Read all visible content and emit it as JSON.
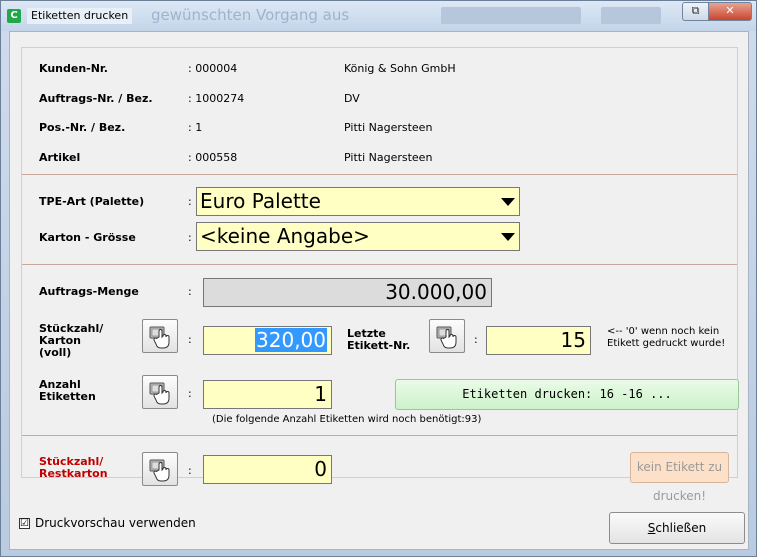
{
  "window": {
    "title": "Etiketten drucken",
    "app_icon_letter": "C",
    "background_hint": "gewünschten Vorgang aus",
    "minimize_label": "⧉",
    "close_label": "✕"
  },
  "info": {
    "kunden_label": "Kunden-Nr.",
    "kunden_value": ": 000004",
    "kunden_name": "König & Sohn GmbH",
    "auftrag_label": "Auftrags-Nr. / Bez.",
    "auftrag_value": ": 1000274",
    "auftrag_name": "DV",
    "pos_label": "Pos.-Nr. / Bez.",
    "pos_value": ": 1",
    "pos_name": "Pitti Nagersteen",
    "artikel_label": "Artikel",
    "artikel_value": ": 000558",
    "artikel_name": "Pitti Nagersteen"
  },
  "tpe": {
    "label": "TPE-Art (Palette)",
    "value": "Euro Palette"
  },
  "karton": {
    "label": "Karton - Grösse",
    "value": "<keine Angabe>"
  },
  "menge": {
    "label": "Auftrags-Menge",
    "value": "30.000,00"
  },
  "stueckzahl": {
    "label_line1": "Stückzahl/",
    "label_line2": "Karton",
    "label_line3": "(voll)",
    "value": "320,00"
  },
  "letzte": {
    "label_line1": "Letzte",
    "label_line2": "Etikett-Nr.",
    "value": "15",
    "hint_line1": "<-- '0' wenn noch kein",
    "hint_line2": "Etikett gedruckt wurde!"
  },
  "anzahl": {
    "label_line1": "Anzahl",
    "label_line2": "Etiketten",
    "value": "1",
    "print_button": "Etiketten drucken: 16 -16 ...",
    "note": "(Die folgende Anzahl Etiketten wird noch benötigt:93)"
  },
  "rest": {
    "label_line1": "Stückzahl/",
    "label_line2": "Restkarton",
    "value": "0",
    "button": "kein Etikett zu drucken!"
  },
  "colon": ":",
  "footer": {
    "preview_label": "Druckvorschau verwenden",
    "preview_checked": "☑",
    "close_button_underlined": "S",
    "close_button_rest": "chließen"
  },
  "colors": {
    "input_bg": "#ffffc4",
    "readonly_bg": "#dcdcdc",
    "separator": "#c8a89a",
    "print_button_bg": "#d4f5d0",
    "disabled_button_bg": "#fde0c8",
    "label_red": "#c00000"
  }
}
